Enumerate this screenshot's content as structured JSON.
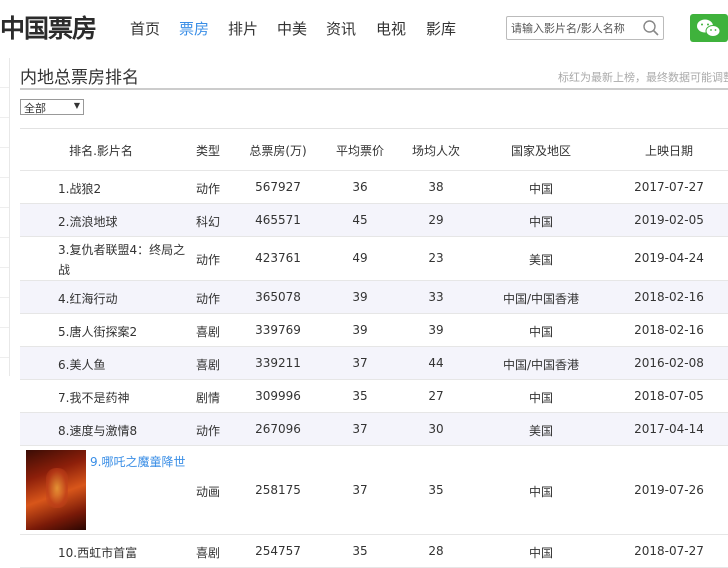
{
  "site": {
    "logo": "中国票房"
  },
  "nav": {
    "items": [
      {
        "label": "首页",
        "active": false
      },
      {
        "label": "票房",
        "active": true
      },
      {
        "label": "排片",
        "active": false
      },
      {
        "label": "中美",
        "active": false
      },
      {
        "label": "资讯",
        "active": false
      },
      {
        "label": "电视",
        "active": false
      },
      {
        "label": "影库",
        "active": false
      }
    ]
  },
  "search": {
    "placeholder": "请输入影片名/影人名称",
    "icon": "search-icon"
  },
  "wechat": {
    "icon": "wechat-icon",
    "color": "#3fb23c"
  },
  "page": {
    "title": "内地总票房排名",
    "note": "标红为最新上榜，最终数据可能调整",
    "filter_value": "全部"
  },
  "table": {
    "headers": [
      "排名.影片名",
      "类型",
      "总票房(万)",
      "平均票价",
      "场均人次",
      "国家及地区",
      "上映日期"
    ],
    "rows": [
      {
        "name": "1.战狼2",
        "type": "动作",
        "gross": "567927",
        "price": "36",
        "people": "38",
        "region": "中国",
        "date": "2017-07-27"
      },
      {
        "name": "2.流浪地球",
        "type": "科幻",
        "gross": "465571",
        "price": "45",
        "people": "29",
        "region": "中国",
        "date": "2019-02-05"
      },
      {
        "name": "3.复仇者联盟4：终局之",
        "name2": "战",
        "type": "动作",
        "gross": "423761",
        "price": "49",
        "people": "23",
        "region": "美国",
        "date": "2019-04-24"
      },
      {
        "name": "4.红海行动",
        "type": "动作",
        "gross": "365078",
        "price": "39",
        "people": "33",
        "region": "中国/中国香港",
        "date": "2018-02-16"
      },
      {
        "name": "5.唐人街探案2",
        "type": "喜剧",
        "gross": "339769",
        "price": "39",
        "people": "39",
        "region": "中国",
        "date": "2018-02-16"
      },
      {
        "name": "6.美人鱼",
        "type": "喜剧",
        "gross": "339211",
        "price": "37",
        "people": "44",
        "region": "中国/中国香港",
        "date": "2016-02-08"
      },
      {
        "name": "7.我不是药神",
        "type": "剧情",
        "gross": "309996",
        "price": "35",
        "people": "27",
        "region": "中国",
        "date": "2018-07-05"
      },
      {
        "name": "8.速度与激情8",
        "type": "动作",
        "gross": "267096",
        "price": "37",
        "people": "30",
        "region": "美国",
        "date": "2017-04-14"
      },
      {
        "name": "9.哪吒之魔童降世",
        "type": "动画",
        "gross": "258175",
        "price": "37",
        "people": "35",
        "region": "中国",
        "date": "2019-07-26",
        "highlight_color": "#3a8ee6"
      },
      {
        "name": "10.西虹市首富",
        "type": "喜剧",
        "gross": "254757",
        "price": "35",
        "people": "28",
        "region": "中国",
        "date": "2018-07-27"
      }
    ]
  }
}
